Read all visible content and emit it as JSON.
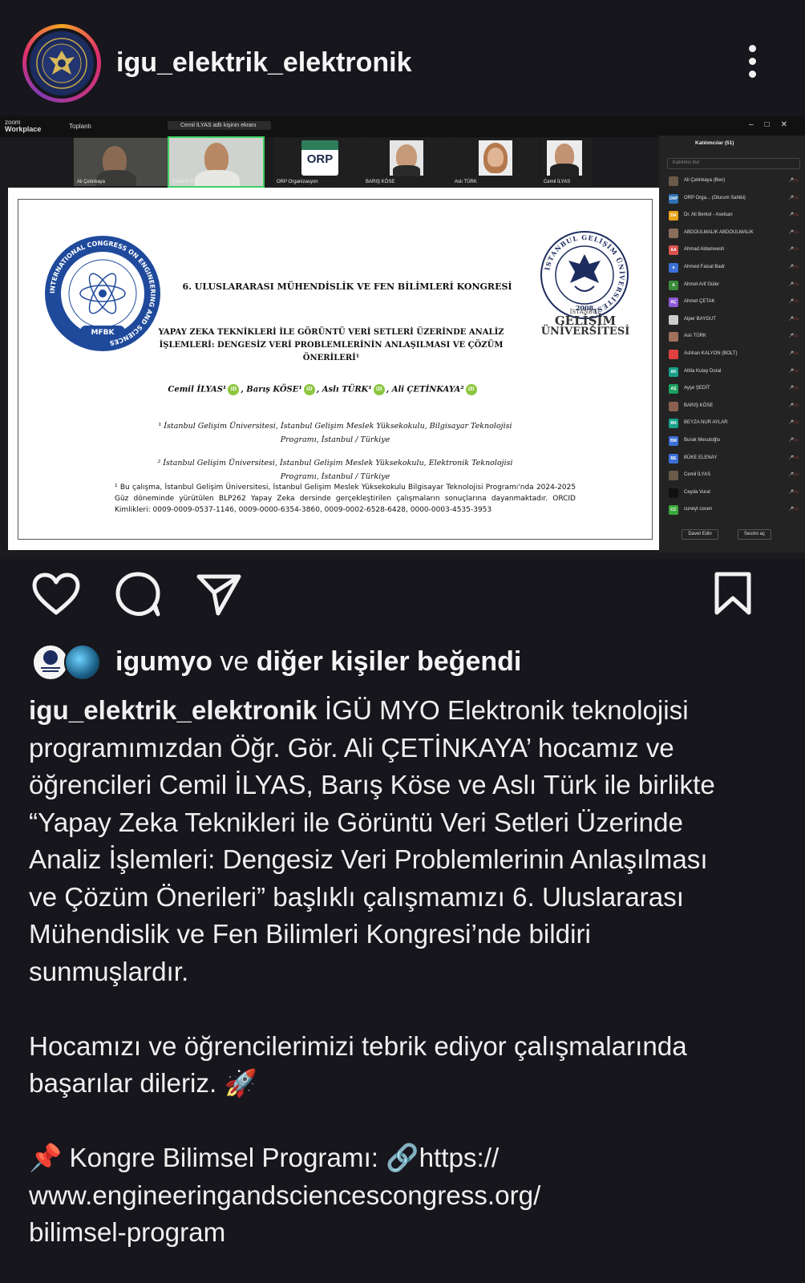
{
  "post": {
    "username": "igu_elektrik_elektronik"
  },
  "zoom": {
    "logo_top": "zoom",
    "logo_bottom": "Workplace",
    "meeting_label": "Toplantı",
    "share_label": "Cemil İLYAS adlı kişinin ekranı",
    "thumbnails": [
      {
        "label": "Ali Çetinkaya"
      },
      {
        "label": "Cemil İLYAS"
      },
      {
        "label": "ORP Organizasyon",
        "logo": "ORP"
      },
      {
        "label": "BARIŞ KÖSE"
      },
      {
        "label": "Aslı TÜRK"
      },
      {
        "label": "Cemil İLYAS"
      }
    ],
    "panel": {
      "title": "Katılımcılar (51)",
      "search_placeholder": "Katılımcı bul",
      "participants": [
        {
          "initials": "",
          "name": "Ali Çetinkaya (Ben)",
          "color": "#6b5a4a"
        },
        {
          "initials": "ORP",
          "name": "ORP Orga... (Oturum Sahibi)",
          "color": "#2d6fb5"
        },
        {
          "initials": "DA",
          "name": "Dr. Ali Berkol - Aselsan",
          "color": "#e8a317"
        },
        {
          "initials": "",
          "name": "ABDOULMALIK ABDOULMALIK",
          "color": "#8a6d5a"
        },
        {
          "initials": "AA",
          "name": "Ahmad Aldameesh",
          "color": "#d9534f"
        },
        {
          "initials": "a",
          "name": "Ahmed Faisal Badr",
          "color": "#3b6fd6"
        },
        {
          "initials": "A",
          "name": "Ahmet Arif Güler",
          "color": "#3a8a3a"
        },
        {
          "initials": "AÇ",
          "name": "Ahmet ÇETAK",
          "color": "#8e5bd6"
        },
        {
          "initials": "",
          "name": "Alper BAYGUT",
          "color": "#cccccc"
        },
        {
          "initials": "",
          "name": "Aslı TÜRK",
          "color": "#a0705a"
        },
        {
          "initials": "",
          "name": "Aslıhan KALYON (BOLT)",
          "color": "#e04040"
        },
        {
          "initials": "AK",
          "name": "Attila Kutay Dural",
          "color": "#1aa08a"
        },
        {
          "initials": "AŞ",
          "name": "Ayşe ŞEDİT",
          "color": "#1aa060"
        },
        {
          "initials": "",
          "name": "BARIŞ KÖSE",
          "color": "#8a6050"
        },
        {
          "initials": "BN",
          "name": "BEYZA NUR AYLAR",
          "color": "#1aa08a"
        },
        {
          "initials": "BM",
          "name": "Burak Mesutoğlu",
          "color": "#3b6fd6"
        },
        {
          "initials": "BE",
          "name": "BÜKE ELENAY",
          "color": "#3b6fd6"
        },
        {
          "initials": "",
          "name": "Cemil İLYAS",
          "color": "#6b5a4a"
        },
        {
          "initials": "",
          "name": "Ceyda Vural",
          "color": "#111111"
        },
        {
          "initials": "CC",
          "name": "cuneyt cocen",
          "color": "#3aa83a"
        }
      ],
      "invite_button": "Davet Edin",
      "mute_button": "Sesimi aç"
    }
  },
  "slide": {
    "congress_title": "6. ULUSLARARASI MÜHENDİSLİK VE FEN BİLİMLERİ KONGRESİ",
    "paper_title_1": "YAPAY ZEKA TEKNİKLERİ İLE GÖRÜNTÜ VERİ SETLERİ ÜZERİNDE ANALİZ",
    "paper_title_2": "İŞLEMLERİ: DENGESİZ VERİ PROBLEMLERİNİN ANLAŞILMASI VE ÇÖZÜM",
    "paper_title_3": "ÖNERİLERİ¹",
    "author_1": "Cemil İLYAS¹",
    "author_2": ", Barış KÖSE¹",
    "author_3": ", Aslı TÜRK¹",
    "author_4": ", Ali ÇETİNKAYA²",
    "orcid": "iD",
    "affiliation_1_a": "¹ İstanbul Gelişim Üniversitesi, İstanbul Gelişim Meslek Yüksekokulu, Bilgisayar Teknolojisi",
    "affiliation_1_b": "Programı, İstanbul / Türkiye",
    "affiliation_2_a": "² İstanbul Gelişim Üniversitesi, İstanbul Gelişim Meslek Yüksekokulu, Elektronik Teknolojisi",
    "affiliation_2_b": "Programı, İstanbul / Türkiye",
    "note": "¹ Bu çalışma, İstanbul Gelişim Üniversitesi, İstanbul Gelişim Meslek Yüksekokulu Bilgisayar Teknolojisi Programı'nda 2024-2025 Güz döneminde yürütülen BLP262 Yapay Zeka dersinde gerçekleştirilen çalışmaların sonuçlarına dayanmaktadır. ORCID Kimlikleri: 0009-0009-0537-1146, 0009-0000-6354-3860, 0009-0002-6528-6428, 0000-0003-4535-3953",
    "mfbk_ring": "INTERNATIONAL CONGRESS ON ENGINEERING AND SCIENCES",
    "mfbk_inner": "ULUSLARARASI MÜHENDİSLİK VE FEN BİLİMLERİ KONGRESİ",
    "mfbk_label": "MFBK",
    "igu_ring": "İSTANBUL GELİŞİM ÜNİVERSİTESİ",
    "igu_year": "2008",
    "igu_name_small": "İSTANBUL",
    "igu_name_1": "GELİŞİM",
    "igu_name_2": "ÜNİVERSİTESİ"
  },
  "likes": {
    "user": "igumyo",
    "connector": " ve ",
    "others": "diğer kişiler beğendi"
  },
  "caption": {
    "user": "igu_elektrik_elektronik",
    "body": " İGÜ MYO Elektronik teknolojisi\nprogramımızdan Öğr. Gör. Ali ÇETİNKAYA’ hocamız ve\nöğrencileri Cemil İLYAS, Barış Köse ve Aslı Türk ile birlikte\n“Yapay Zeka Teknikleri ile Görüntü Veri Setleri Üzerinde\nAnaliz İşlemleri: Dengesiz Veri Problemlerinin Anlaşılması\nve Çözüm Önerileri” başlıklı çalışmamızı 6. Uluslararası\nMühendislik ve Fen Bilimleri Kongresi’nde  bildiri\nsunmuşlardır.",
    "congrats": "Hocamızı ve öğrencilerimizi tebrik ediyor çalışmalarında\nbaşarılar dileriz. 🚀",
    "program": "📌 Kongre Bilimsel Programı: 🔗https://\nwww.engineeringandsciencescongress.org/\nbilimsel-program"
  },
  "icons": [
    "more-icon",
    "heart-icon",
    "comment-icon",
    "share-icon",
    "bookmark-icon"
  ],
  "colors": {
    "background": "#16161c",
    "text": "#f2f2f2",
    "story_ring": [
      "#f5a623",
      "#e1306c",
      "#833ab4"
    ],
    "orcid": "#8cc63f",
    "active_speaker": "#3fcf63"
  }
}
